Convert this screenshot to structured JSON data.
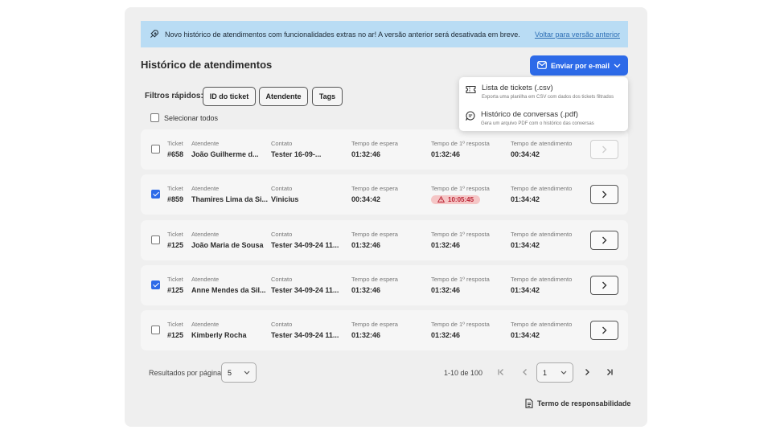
{
  "banner": {
    "message": "Novo histórico de atendimentos com funcionalidades extras no ar! A versão anterior será desativada em breve.",
    "link": "Voltar para versão anterior"
  },
  "page_title": "Histórico de atendimentos",
  "email_button": "Enviar por e-mail",
  "dropdown": {
    "items": [
      {
        "title": "Lista de tickets (.csv)",
        "subtitle": "Exporta uma planilha em CSV com dados dos tickets filtrados"
      },
      {
        "title": "Histórico de conversas (.pdf)",
        "subtitle": "Gera um arquivo PDF com o histórico das conversas"
      }
    ]
  },
  "filters": {
    "label": "Filtros rápidos:",
    "chips": [
      "ID do ticket",
      "Atendente",
      "Tags"
    ]
  },
  "select_all": "Selecionar todos",
  "labels": {
    "ticket": "Ticket",
    "agent": "Atendente",
    "contact": "Contato",
    "wait": "Tempo de espera",
    "first_response": "Tempo de 1º resposta",
    "service": "Tempo de atendimento"
  },
  "rows": [
    {
      "checked": false,
      "ticket": "#658",
      "agent": "João Guilherme d...",
      "contact": "Tester 16-09-...",
      "wait": "01:32:46",
      "first_response": "01:32:46",
      "first_warning": false,
      "service": "00:34:42",
      "disabled": true
    },
    {
      "checked": true,
      "ticket": "#859",
      "agent": "Thamires Lima da Si...",
      "contact": "Vinicius",
      "wait": "00:34:42",
      "first_response": "10:05:45",
      "first_warning": true,
      "service": "01:34:42",
      "disabled": false
    },
    {
      "checked": false,
      "ticket": "#125",
      "agent": "João Maria de Sousa",
      "contact": "Tester 34-09-24 11...",
      "wait": "01:32:46",
      "first_response": "01:32:46",
      "first_warning": false,
      "service": "01:34:42",
      "disabled": false
    },
    {
      "checked": true,
      "ticket": "#125",
      "agent": "Anne Mendes da Sil...",
      "contact": "Tester 34-09-24 11...",
      "wait": "01:32:46",
      "first_response": "01:32:46",
      "first_warning": false,
      "service": "01:34:42",
      "disabled": false
    },
    {
      "checked": false,
      "ticket": "#125",
      "agent": "Kimberly Rocha",
      "contact": "Tester 34-09-24 11...",
      "wait": "01:32:46",
      "first_response": "01:32:46",
      "first_warning": false,
      "service": "01:34:42",
      "disabled": false
    }
  ],
  "pagination": {
    "results_label": "Resultados por página",
    "page_size": "5",
    "range": "1-10 de 100",
    "current_page": "1"
  },
  "terms": "Termo de responsabilidade",
  "colors": {
    "primary": "#2d6ae8",
    "banner_bg": "#b9dcf4",
    "warning_bg": "#f5c6c6",
    "warning_text": "#bb2233"
  }
}
